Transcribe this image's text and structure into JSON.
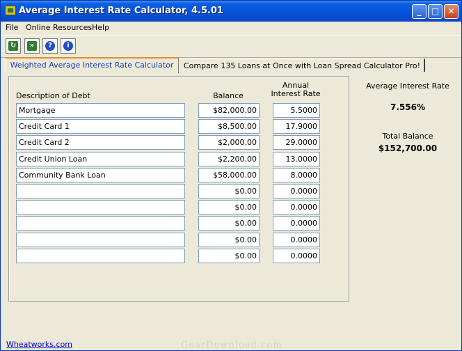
{
  "window": {
    "title": "Average Interest Rate Calculator, 4.5.01"
  },
  "titlebar_buttons": {
    "minimize": "_",
    "maximize": "□",
    "close": "✕"
  },
  "menu": [
    "File",
    "Online Resources",
    "Help"
  ],
  "toolbar": [
    {
      "icon": "refresh-icon",
      "glyph": "↻",
      "color": "#2e7d32"
    },
    {
      "icon": "export-icon",
      "glyph": "»",
      "color": "#2e7d32"
    },
    {
      "icon": "help-icon",
      "glyph": "?",
      "color": "#1e4fc6"
    },
    {
      "icon": "info-icon",
      "glyph": "i",
      "color": "#1e4fc6"
    }
  ],
  "tabs": {
    "active": "Weighted Average Interest Rate Calculator",
    "inactive": "Compare 135 Loans at Once with Loan Spread Calculator Pro!"
  },
  "table": {
    "headers": {
      "description": "Description of Debt",
      "balance": "Balance",
      "rate": "Annual Interest Rate"
    },
    "rows": [
      {
        "description": "Mortgage",
        "balance": "$82,000.00",
        "rate": "5.5000"
      },
      {
        "description": "Credit Card 1",
        "balance": "$8,500.00",
        "rate": "17.9000"
      },
      {
        "description": "Credit Card 2",
        "balance": "$2,000.00",
        "rate": "29.0000"
      },
      {
        "description": "Credit Union Loan",
        "balance": "$2,200.00",
        "rate": "13.0000"
      },
      {
        "description": "Community Bank Loan",
        "balance": "$58,000.00",
        "rate": "8.0000"
      },
      {
        "description": "",
        "balance": "$0.00",
        "rate": "0.0000"
      },
      {
        "description": "",
        "balance": "$0.00",
        "rate": "0.0000"
      },
      {
        "description": "",
        "balance": "$0.00",
        "rate": "0.0000"
      },
      {
        "description": "",
        "balance": "$0.00",
        "rate": "0.0000"
      },
      {
        "description": "",
        "balance": "$0.00",
        "rate": "0.0000"
      }
    ]
  },
  "results": {
    "avg_rate_label": "Average Interest Rate",
    "avg_rate_value": "7.556%",
    "total_balance_label": "Total Balance",
    "total_balance_value": "$152,700.00"
  },
  "status": {
    "link": "Wheatworks.com",
    "watermark": "GearDownload.com"
  },
  "colors": {
    "titlebar": "#0653d8",
    "active_tab_text": "#1a40c0",
    "tab_highlight": "#e68b2c",
    "link": "#0000c8"
  }
}
